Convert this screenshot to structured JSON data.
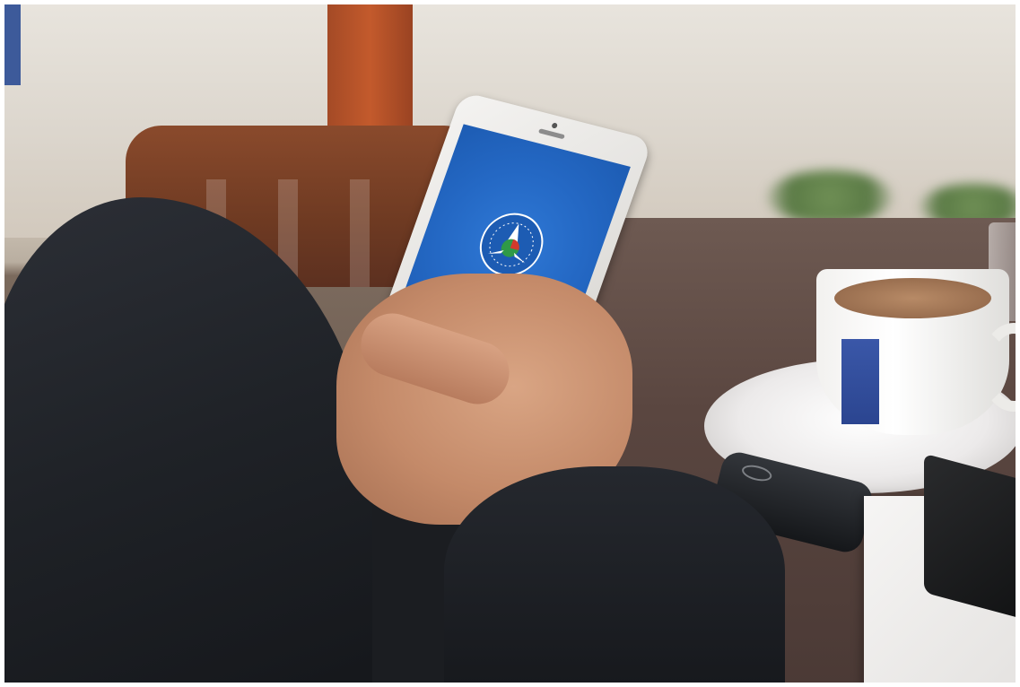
{
  "scene": {
    "description_tag": "photo",
    "app_logo_text": "",
    "colors": {
      "screen_blue": "#2468c4",
      "sleeve": "#1f2227",
      "table": "#5a4640",
      "cup_label": "#3a57a8",
      "chair": "#7a4027"
    }
  }
}
